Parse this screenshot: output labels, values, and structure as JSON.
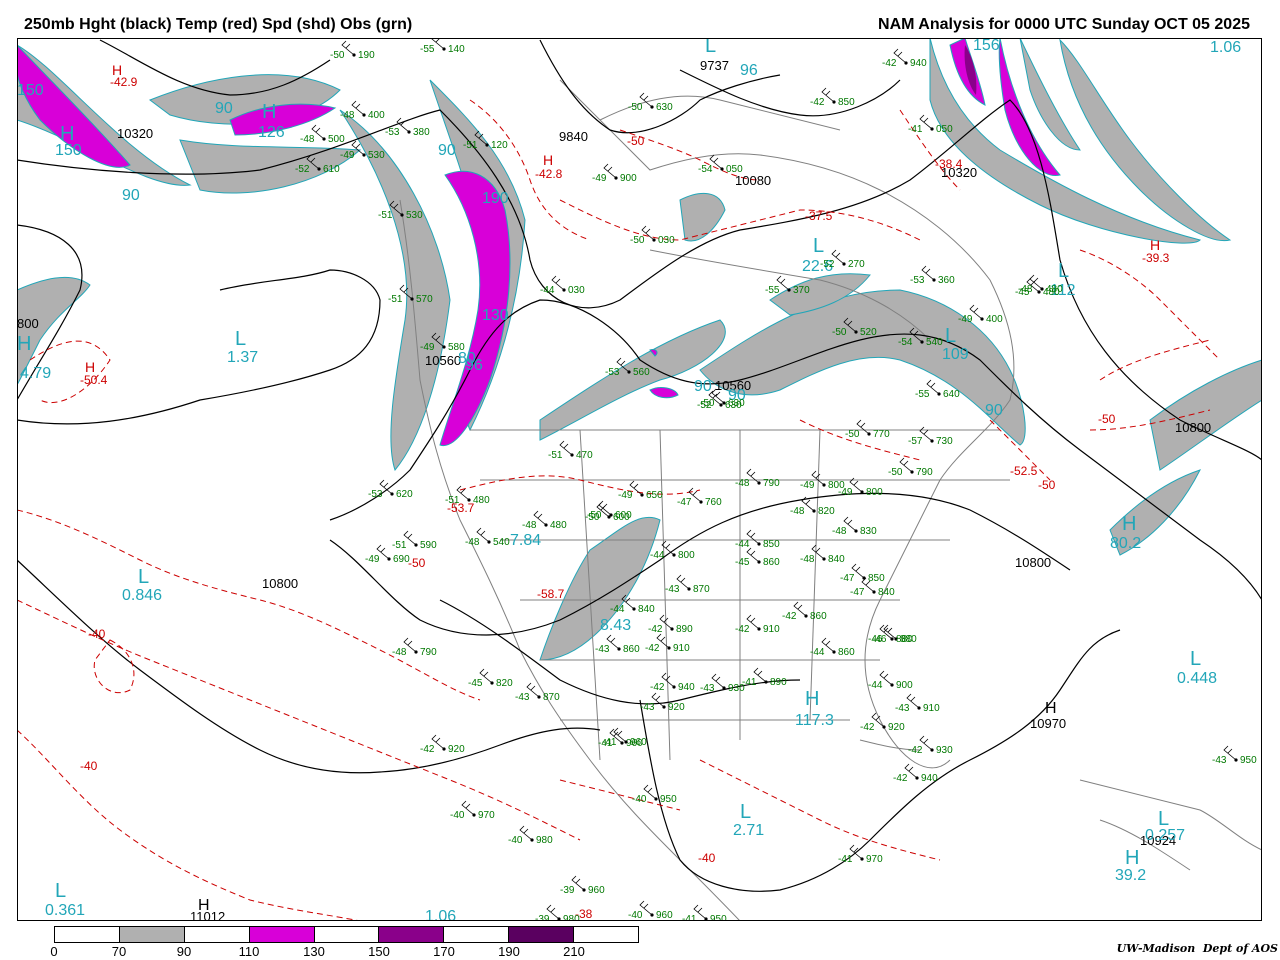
{
  "header": {
    "left_title": "250mb Hght (black) Temp (red) Spd (shd) Obs (grn)",
    "right_title": "NAM Analysis for 0000 UTC Sunday  OCT 05 2025"
  },
  "colors": {
    "height_contour": "#000000",
    "temp_contour": "#cc0000",
    "speed_70_90": "#b0b0b0",
    "speed_110_130": "#d800d8",
    "speed_150_170": "#8a008a",
    "speed_190_210": "#5a0060",
    "speed_label": "#22a6b8",
    "obs": "#007800",
    "geography": "#808080"
  },
  "legend": {
    "scale_labels": [
      "0",
      "70",
      "90",
      "110",
      "130",
      "150",
      "170",
      "190",
      "210"
    ],
    "segment_fills": [
      "#ffffff",
      "#b0b0b0",
      "#ffffff",
      "#d800d8",
      "#ffffff",
      "#8a008a",
      "#ffffff",
      "#5a0060",
      "#ffffff"
    ]
  },
  "credit": {
    "org": "UW-Madison",
    "dept": "Dept of AOS"
  },
  "height_labels": [
    "10320",
    "9840",
    "10080",
    "10320",
    "10560",
    "10560",
    "10800",
    "10800",
    "10800",
    "10970",
    "10924",
    "11012",
    "800",
    "9737"
  ],
  "temp_labels": [
    "-42.9",
    "-42.8",
    "-37.5",
    "-38.4",
    "-39.3",
    "-50.4",
    "-53.7",
    "-58.7",
    "-52.5",
    "-50",
    "-50",
    "-50",
    "-50",
    "-40",
    "-40",
    "-40",
    "-38"
  ],
  "speed_labels": [
    "150",
    "150",
    "90",
    "90",
    "90",
    "126",
    "190",
    "130",
    "1.37",
    "4.79",
    "0.846",
    "7.84",
    "8.43",
    "80.2",
    "0.448",
    "2.71",
    "117.3",
    "39.2",
    "0.361",
    "1.06",
    "1.06",
    "0.257",
    "22.6",
    "109",
    "112",
    "156",
    "90",
    "90",
    "90",
    "80",
    "96",
    "96"
  ],
  "pressure_centers": [
    "H",
    "H",
    "H",
    "H",
    "H",
    "H",
    "L",
    "L",
    "L",
    "L",
    "L",
    "L",
    "L",
    "L",
    "L",
    "L"
  ],
  "observations": [
    "-50 190",
    "-55 140",
    "-48 400",
    "-53 380",
    "-48 500",
    "-49 530",
    "-52 610",
    "-51 530",
    "-51 570",
    "-49 580",
    "-51 470",
    "-53 620",
    "-51 480",
    "-51 590",
    "-48 540",
    "-48 480",
    "-50 600",
    "-44 030",
    "-52 270",
    "-47 760",
    "-49 690",
    "-48 790",
    "-50 770",
    "-50 790",
    "-49 800",
    "-48 820",
    "-48 830",
    "-48 840",
    "-44 800",
    "-43 870",
    "-44 840",
    "-42 890",
    "-42 910",
    "-43 860",
    "-42 940",
    "-43 930",
    "-41 960",
    "-40 970",
    "-39 960",
    "-39 980",
    "-40 960",
    "-41 950",
    "-41 970",
    "-42 920",
    "-42 930",
    "-42 940",
    "-43 910",
    "-44 900",
    "-46 880",
    "-47 850",
    "-47 840",
    "-44 860",
    "-41 890",
    "-42 860",
    "-44 850",
    "-45 860",
    "-48 790",
    "-49 800",
    "-50 630",
    "-52 630",
    "-55 370",
    "-53 360",
    "-49 400",
    "-45 480",
    "-50 520",
    "-54 540",
    "-55 640",
    "-57 730",
    "-50 600",
    "-49 650",
    "-53 560",
    "-41 050",
    "-42 940",
    "-42 850",
    "-50 630",
    "-49 900",
    "-50 030",
    "-54 050",
    "-51 120",
    "-48 480",
    "-42 910",
    "-43 950",
    "-42 920",
    "-41 960",
    "-40 980",
    "-40 950",
    "-43 920",
    "-45 820",
    "-43 870",
    "-46 880"
  ]
}
